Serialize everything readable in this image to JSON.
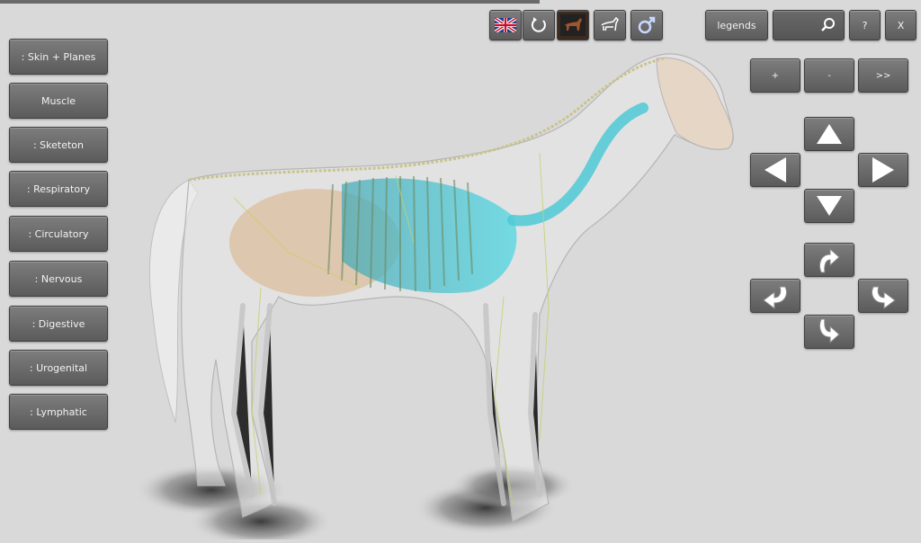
{
  "systems": [
    {
      "label": ": Skin + Planes"
    },
    {
      "label": "Muscle"
    },
    {
      "label": ": Sketeton"
    },
    {
      "label": ": Respiratory"
    },
    {
      "label": ": Circulatory"
    },
    {
      "label": ": Nervous"
    },
    {
      "label": ": Digestive"
    },
    {
      "label": ": Urogenital"
    },
    {
      "label": ": Lymphatic"
    }
  ],
  "toolbar": {
    "legends": "legends",
    "help": "?",
    "close": "X"
  },
  "zoom": {
    "in": "+",
    "out": "-",
    "next": ">>"
  },
  "colors": {
    "button": "#666666",
    "background": "#d9d9d9",
    "trachea": "#4ec9d6"
  }
}
